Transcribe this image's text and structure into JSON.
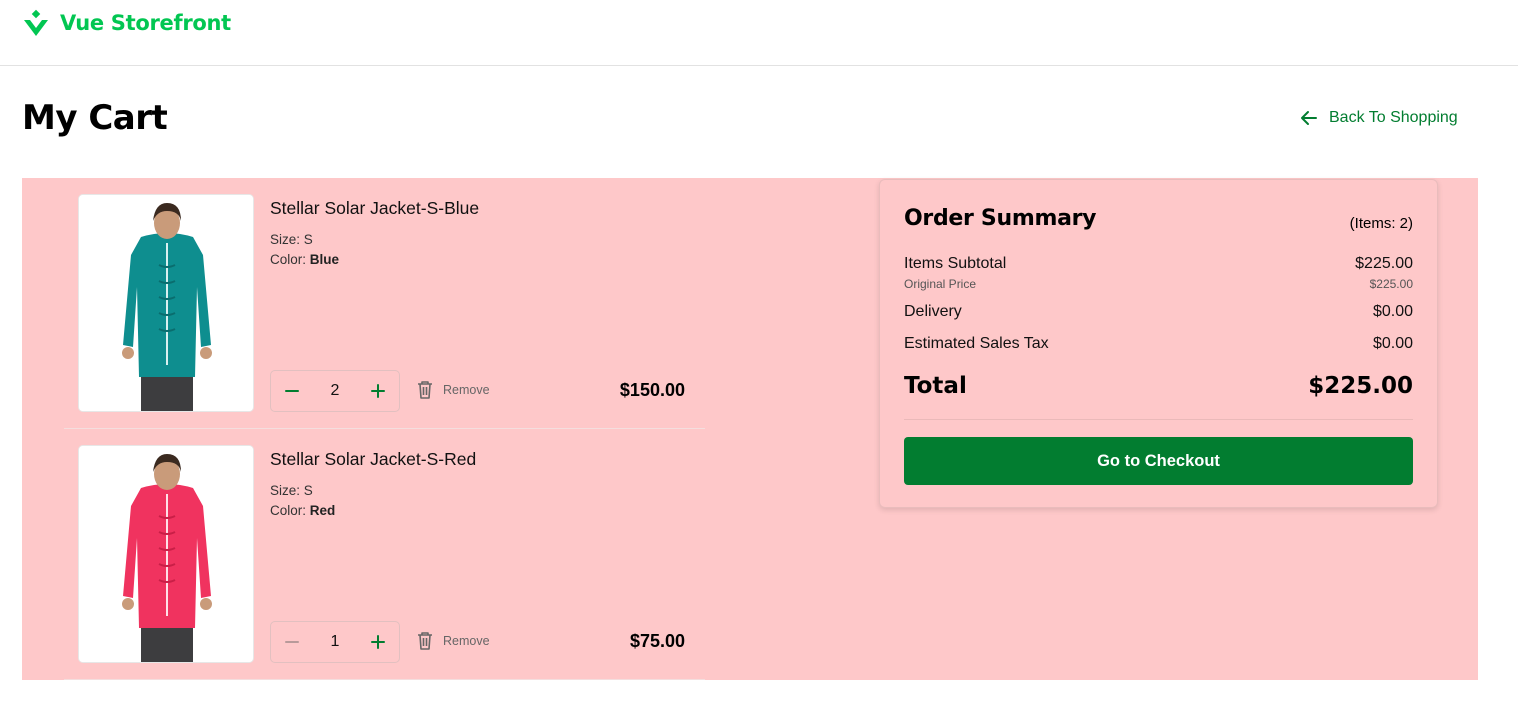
{
  "brand": {
    "name": "Vue Storefront",
    "color": "#02c652"
  },
  "page": {
    "title": "My Cart",
    "back_label": "Back To Shopping"
  },
  "colors": {
    "accent": "#027d30",
    "cart_bg": "#fec8c9"
  },
  "cart": {
    "items": [
      {
        "name": "Stellar Solar Jacket-S-Blue",
        "size_label": "Size:",
        "size": "S",
        "color_label": "Color:",
        "color": "Blue",
        "quantity": "2",
        "remove_label": "Remove",
        "price": "$150.00",
        "jacket_color": "#0e8e8f"
      },
      {
        "name": "Stellar Solar Jacket-S-Red",
        "size_label": "Size:",
        "size": "S",
        "color_label": "Color:",
        "color": "Red",
        "quantity": "1",
        "remove_label": "Remove",
        "price": "$75.00",
        "jacket_color": "#f0335f"
      }
    ]
  },
  "summary": {
    "title": "Order Summary",
    "items_count": "(Items: 2)",
    "subtotal_label": "Items Subtotal",
    "subtotal": "$225.00",
    "original_label": "Original Price",
    "original": "$225.00",
    "delivery_label": "Delivery",
    "delivery": "$0.00",
    "tax_label": "Estimated Sales Tax",
    "tax": "$0.00",
    "total_label": "Total",
    "total": "$225.00",
    "checkout_label": "Go to Checkout"
  }
}
